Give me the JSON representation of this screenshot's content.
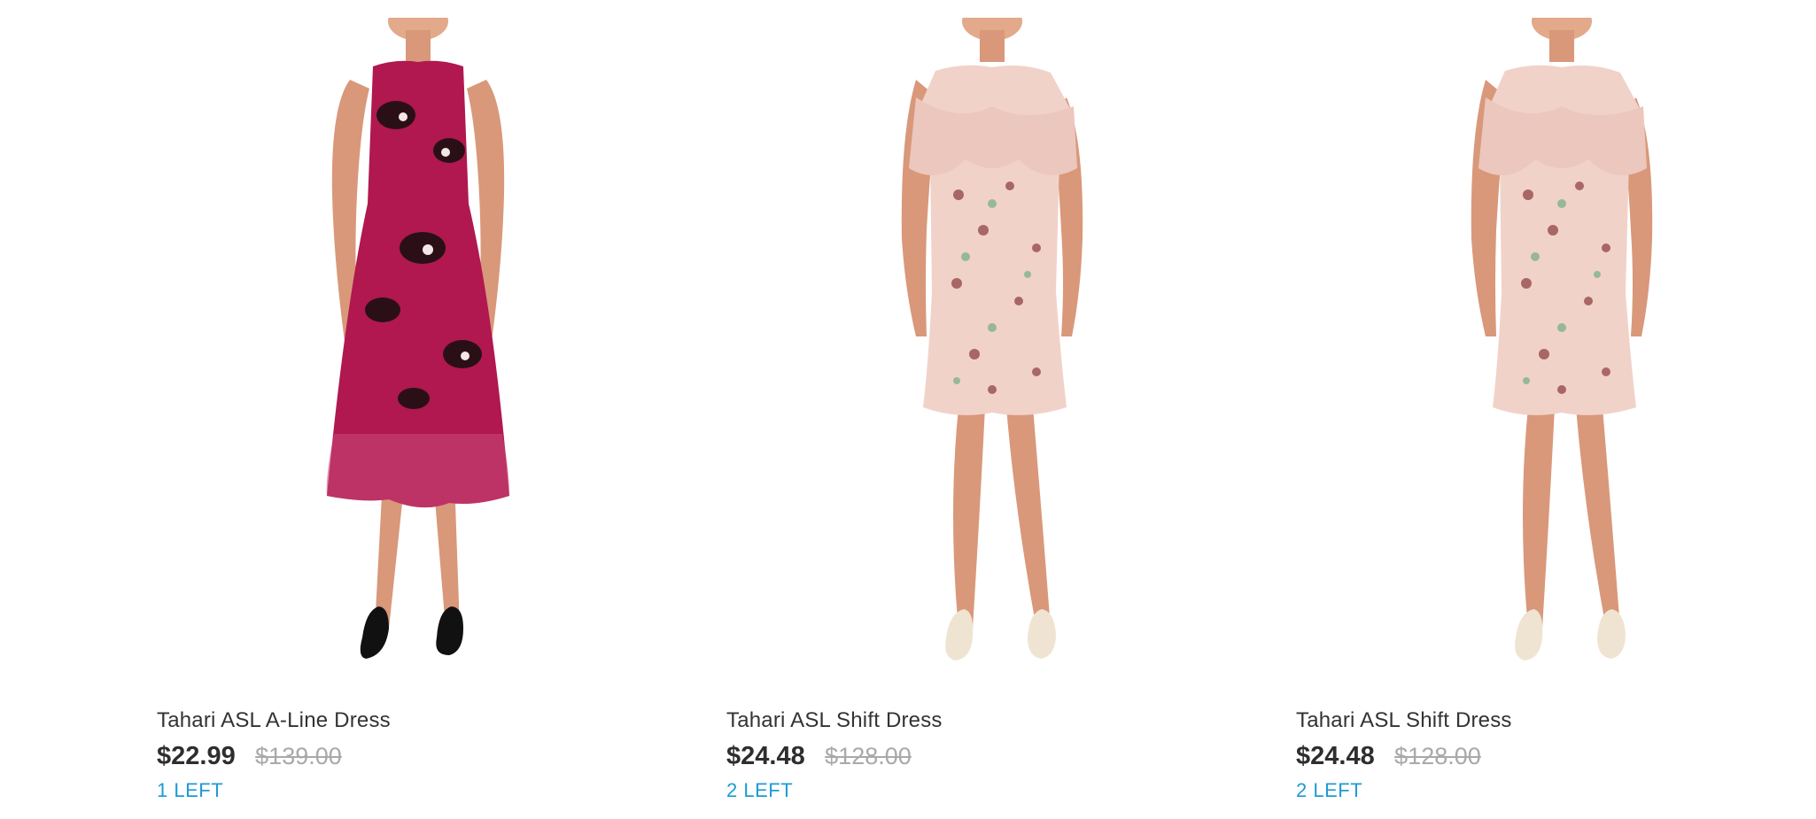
{
  "products": [
    {
      "name": "Tahari ASL A-Line Dress",
      "sale_price": "$22.99",
      "original_price": "$139.00",
      "stock": "1 LEFT",
      "colors": {
        "dress": "#b0184f",
        "shoes": "#111111"
      }
    },
    {
      "name": "Tahari ASL Shift Dress",
      "sale_price": "$24.48",
      "original_price": "$128.00",
      "stock": "2 LEFT",
      "colors": {
        "dress": "#f1d2c9",
        "shoes": "#efe4d2"
      }
    },
    {
      "name": "Tahari ASL Shift Dress",
      "sale_price": "$24.48",
      "original_price": "$128.00",
      "stock": "2 LEFT",
      "colors": {
        "dress": "#f1d2c9",
        "shoes": "#efe4d2"
      }
    }
  ],
  "colors": {
    "stock_text": "#1e9ad6",
    "title_text": "#333333",
    "original_price_text": "#a9a9a9"
  }
}
